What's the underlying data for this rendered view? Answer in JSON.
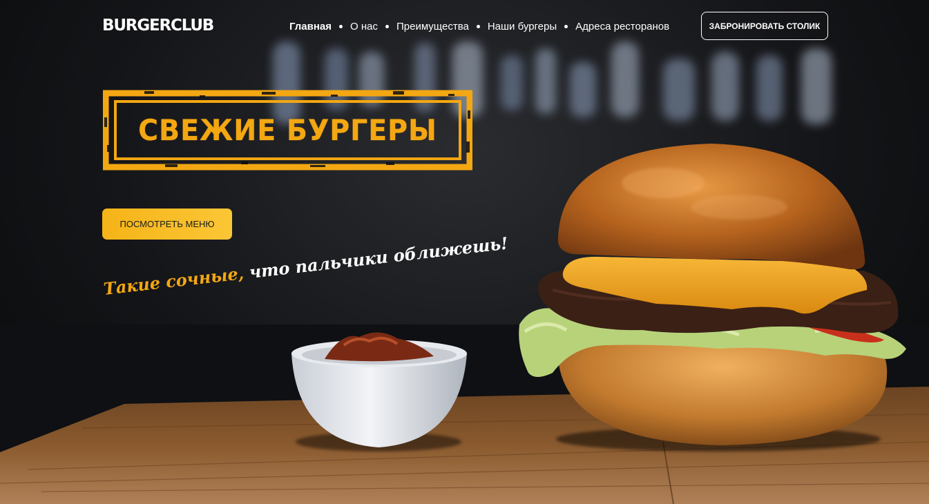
{
  "header": {
    "logo": "BURGERCLUB",
    "nav": [
      {
        "label": "Главная",
        "active": true
      },
      {
        "label": "О нас",
        "active": false
      },
      {
        "label": "Преимущества",
        "active": false
      },
      {
        "label": "Наши бургеры",
        "active": false
      },
      {
        "label": "Адреса ресторанов",
        "active": false
      }
    ],
    "book_button": "ЗАБРОНИРОВАТЬ СТОЛИК"
  },
  "hero": {
    "headline": "СВЕЖИЕ БУРГЕРЫ",
    "menu_button": "ПОСМОТРЕТЬ МЕНЮ",
    "slogan_accent": "Такие сочные,",
    "slogan_rest": " что пальчики оближешь!"
  },
  "colors": {
    "accent": "#f3a712",
    "button": "#f5b418",
    "text": "#ffffff"
  }
}
